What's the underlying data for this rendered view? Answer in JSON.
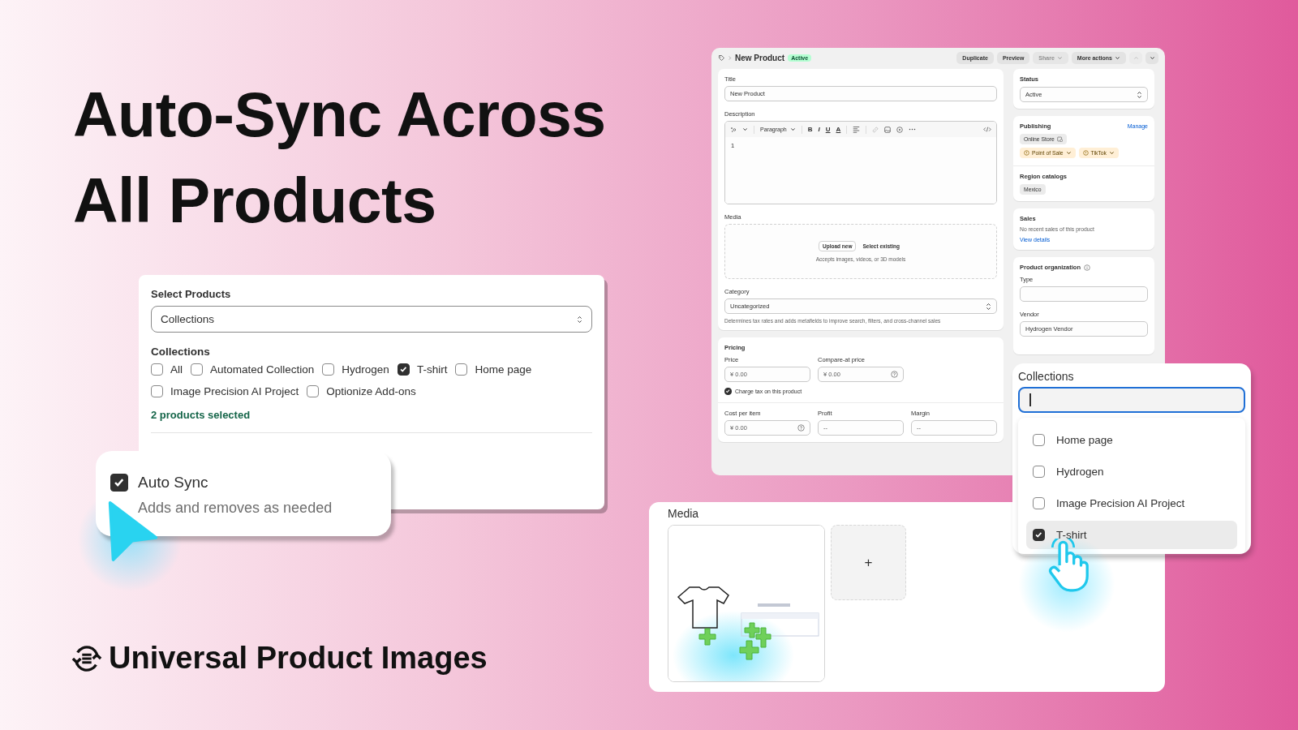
{
  "headline": [
    "Auto-Sync Across",
    "All Products"
  ],
  "brand": {
    "name": "Universal Product Images"
  },
  "select_panel": {
    "title": "Select Products",
    "dropdown": "Collections",
    "group_label": "Collections",
    "options": [
      {
        "label": "All",
        "checked": false
      },
      {
        "label": "Automated Collection",
        "checked": false
      },
      {
        "label": "Hydrogen",
        "checked": false
      },
      {
        "label": "T-shirt",
        "checked": true
      },
      {
        "label": "Home page",
        "checked": false
      },
      {
        "label": "Image Precision AI Project",
        "checked": false
      },
      {
        "label": "Optionize Add-ons",
        "checked": false
      }
    ],
    "summary": "2 products selected"
  },
  "auto_sync": {
    "label": "Auto Sync",
    "checked": true,
    "description": "Adds and removes as needed"
  },
  "editor": {
    "title": "New Product",
    "badge": "Active",
    "actions": [
      {
        "label": "Duplicate",
        "disabled": false,
        "dropdown": false
      },
      {
        "label": "Preview",
        "disabled": false,
        "dropdown": false
      },
      {
        "label": "Share",
        "disabled": true,
        "dropdown": true
      },
      {
        "label": "More actions",
        "disabled": false,
        "dropdown": true
      }
    ],
    "nav": [
      {
        "kind": "up",
        "disabled": true
      },
      {
        "kind": "down",
        "disabled": false
      }
    ],
    "title_field": {
      "label": "Title",
      "value": "New Product"
    },
    "description": {
      "label": "Description",
      "format": "Paragraph",
      "marks": [
        "B",
        "I",
        "U",
        "A"
      ],
      "body": "1"
    },
    "media": {
      "label": "Media",
      "buttons": [
        "Upload new",
        "Select existing"
      ],
      "hint": "Accepts images, videos, or 3D models"
    },
    "category": {
      "label": "Category",
      "value": "Uncategorized",
      "help": "Determines tax rates and adds metafields to improve search, filters, and cross-channel sales"
    },
    "pricing": {
      "title": "Pricing",
      "top_fields": [
        {
          "label": "Price",
          "currency": "¥",
          "value": "0.00",
          "help": false
        },
        {
          "label": "Compare-at price",
          "currency": "¥",
          "value": "0.00",
          "help": true
        }
      ],
      "charge_tax": {
        "label": "Charge tax on this product",
        "checked": true
      },
      "bottom_fields": [
        {
          "label": "Cost per item",
          "currency": "¥",
          "value": "0.00",
          "help": true
        },
        {
          "label": "Profit",
          "value": "--",
          "help": false
        },
        {
          "label": "Margin",
          "value": "--",
          "help": false
        }
      ]
    },
    "status": {
      "label": "Status",
      "value": "Active"
    },
    "publishing": {
      "title": "Publishing",
      "action": "Manage",
      "channels": [
        {
          "name": "Online Store",
          "kind": "plain"
        },
        {
          "name": "Point of Sale",
          "kind": "warning"
        },
        {
          "name": "TikTok",
          "kind": "warning"
        }
      ]
    },
    "region_catalogs": {
      "title": "Region catalogs",
      "items": [
        "Mexico"
      ]
    },
    "sales": {
      "title": "Sales",
      "text": "No recent sales of this product",
      "link": "View details"
    },
    "organization": {
      "title": "Product organization",
      "type_label": "Type",
      "vendor_label": "Vendor",
      "vendor_value": "Hydrogen Vendor"
    }
  },
  "media_card": {
    "title": "Media",
    "tiles": [
      {
        "kind": "picture"
      },
      {
        "kind": "add",
        "label": "+"
      }
    ]
  },
  "collections_dropdown": {
    "title": "Collections",
    "options": [
      {
        "label": "Home page",
        "checked": false,
        "selected": false
      },
      {
        "label": "Hydrogen",
        "checked": false,
        "selected": false
      },
      {
        "label": "Image Precision AI Project",
        "checked": false,
        "selected": false
      },
      {
        "label": "T-shirt",
        "checked": true,
        "selected": true
      }
    ]
  }
}
